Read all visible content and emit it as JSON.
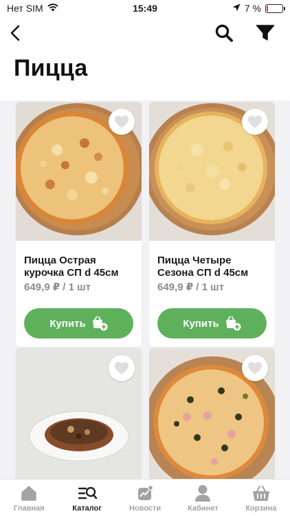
{
  "status_bar": {
    "carrier": "Нет SIM",
    "time": "15:49",
    "battery_text": "7 %",
    "battery_level": 0.07
  },
  "header": {
    "title": "Пицца",
    "back_icon": "chevron-left-icon",
    "search_icon": "search-icon",
    "filter_icon": "filter-icon"
  },
  "products": [
    {
      "name": "Пицца Острая курочка  СП d 45см",
      "price": "649,9 ₽ / 1 шт",
      "buy_label": "Купить"
    },
    {
      "name": "Пицца Четыре Сезона  СП d 45см",
      "price": "649,9 ₽ / 1 шт",
      "buy_label": "Купить"
    },
    {
      "name": "",
      "price": "",
      "buy_label": ""
    },
    {
      "name": "",
      "price": "",
      "buy_label": ""
    }
  ],
  "tabs": [
    {
      "label": "Главная",
      "icon": "home-icon",
      "active": false
    },
    {
      "label": "Каталог",
      "icon": "catalog-icon",
      "active": true
    },
    {
      "label": "Новости",
      "icon": "news-icon",
      "active": false
    },
    {
      "label": "Кабинет",
      "icon": "profile-icon",
      "active": false
    },
    {
      "label": "Корзина",
      "icon": "basket-icon",
      "active": false
    }
  ],
  "colors": {
    "accent_green": "#5fb05b",
    "tab_inactive": "#a3a3a3",
    "battery_low": "#e53935"
  }
}
